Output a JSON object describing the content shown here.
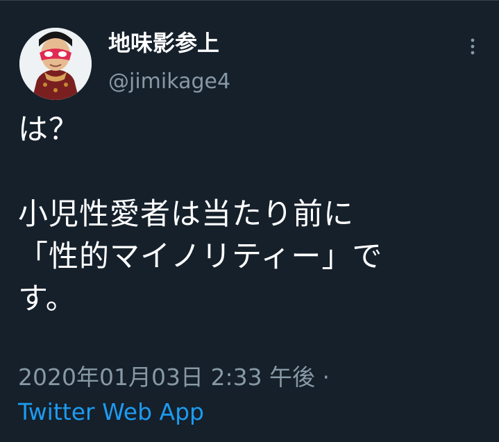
{
  "author": {
    "display_name": "地味影参上",
    "handle": "@jimikage4",
    "avatar_icon": "avatar-icon"
  },
  "tweet": {
    "text": "は？\n\n小児性愛者は当たり前に\n「性的マイノリティー」で\nす。",
    "timestamp": "2020年01月03日 2:33 午後 ·",
    "source": "Twitter Web App"
  },
  "icons": {
    "more": "more-options-icon"
  },
  "colors": {
    "background": "#15202b",
    "secondary_text": "#8899a6",
    "link": "#1d9bf0"
  }
}
